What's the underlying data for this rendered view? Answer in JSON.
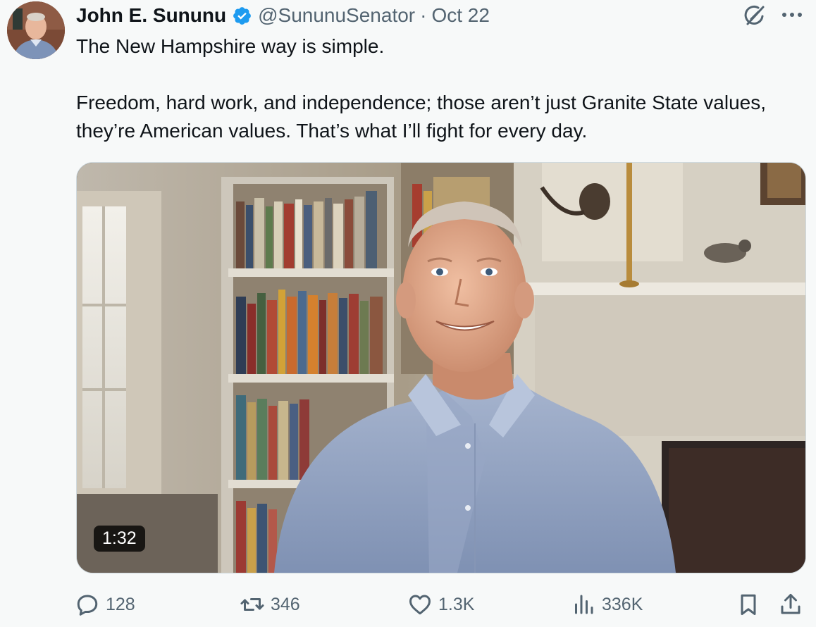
{
  "tweet": {
    "author_name": "John E. Sununu",
    "handle": "@SununuSenator",
    "separator": "·",
    "date": "Oct 22",
    "paragraphs": [
      "The New Hampshire way is simple.",
      "Freedom, hard work, and independence; those aren’t just Granite State values, they’re American values. That’s what I’ll fight for every day."
    ],
    "video_duration": "1:32"
  },
  "actions": {
    "replies": "128",
    "reposts": "346",
    "likes": "1.3K",
    "views": "336K"
  },
  "colors": {
    "text": "#0f1419",
    "secondary": "#536471",
    "verified": "#1d9bf0",
    "background": "#f7f9f9"
  },
  "icons": [
    "verified-badge-icon",
    "grok-icon",
    "more-icon",
    "reply-icon",
    "retweet-icon",
    "like-icon",
    "views-icon",
    "bookmark-icon",
    "share-icon"
  ]
}
